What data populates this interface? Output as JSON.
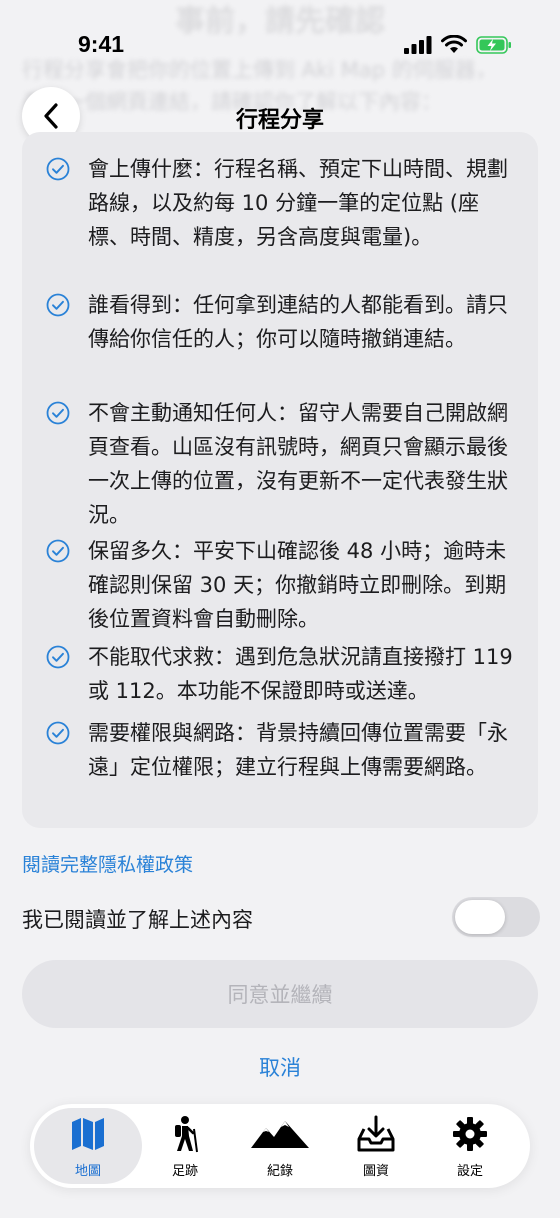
{
  "background": {
    "heading": "事前，請先確認",
    "lines": [
      "行程分享會把你的位置上傳到 Aki Map 的伺服器，",
      "產生一個網頁連結，請確認你了解以下內容："
    ]
  },
  "status_bar": {
    "time": "9:41"
  },
  "nav": {
    "title": "行程分享",
    "back_icon": "chevron-left-icon"
  },
  "disclosures": [
    {
      "text": "會上傳什麼：行程名稱、預定下山時間、規劃路線，以及約每 10 分鐘一筆的定位點 (座標、時間、精度，另含高度與電量)。"
    },
    {
      "text": "誰看得到：任何拿到連結的人都能看到。請只傳給你信任的人；你可以隨時撤銷連結。"
    },
    {
      "text": "不會主動通知任何人：留守人需要自己開啟網頁查看。山區沒有訊號時，網頁只會顯示最後一次上傳的位置，沒有更新不一定代表發生狀況。"
    },
    {
      "text": "保留多久：平安下山確認後 48 小時；逾時未確認則保留 30 天；你撤銷時立即刪除。到期後位置資料會自動刪除。"
    },
    {
      "text": "不能取代求救：遇到危急狀況請直接撥打 119 或 112。本功能不保證即時或送達。"
    },
    {
      "text": "需要權限與網路：背景持續回傳位置需要「永遠」定位權限；建立行程與上傳需要網路。"
    }
  ],
  "privacy_link": "閱讀完整隱私權政策",
  "acknowledge": {
    "label": "我已閱讀並了解上述內容",
    "checked": false
  },
  "primary_button": {
    "label": "同意並繼續",
    "enabled": false
  },
  "cancel_label": "取消",
  "tabs": [
    {
      "label": "地圖",
      "icon": "map-icon",
      "active": true
    },
    {
      "label": "足跡",
      "icon": "hiker-icon",
      "active": false
    },
    {
      "label": "紀錄",
      "icon": "mountains-icon",
      "active": false
    },
    {
      "label": "圖資",
      "icon": "download-tray-icon",
      "active": false
    },
    {
      "label": "設定",
      "icon": "gear-icon",
      "active": false
    }
  ],
  "colors": {
    "accent": "#2a82d7",
    "tab_active": "#1a6fd1",
    "battery": "#34c759"
  }
}
